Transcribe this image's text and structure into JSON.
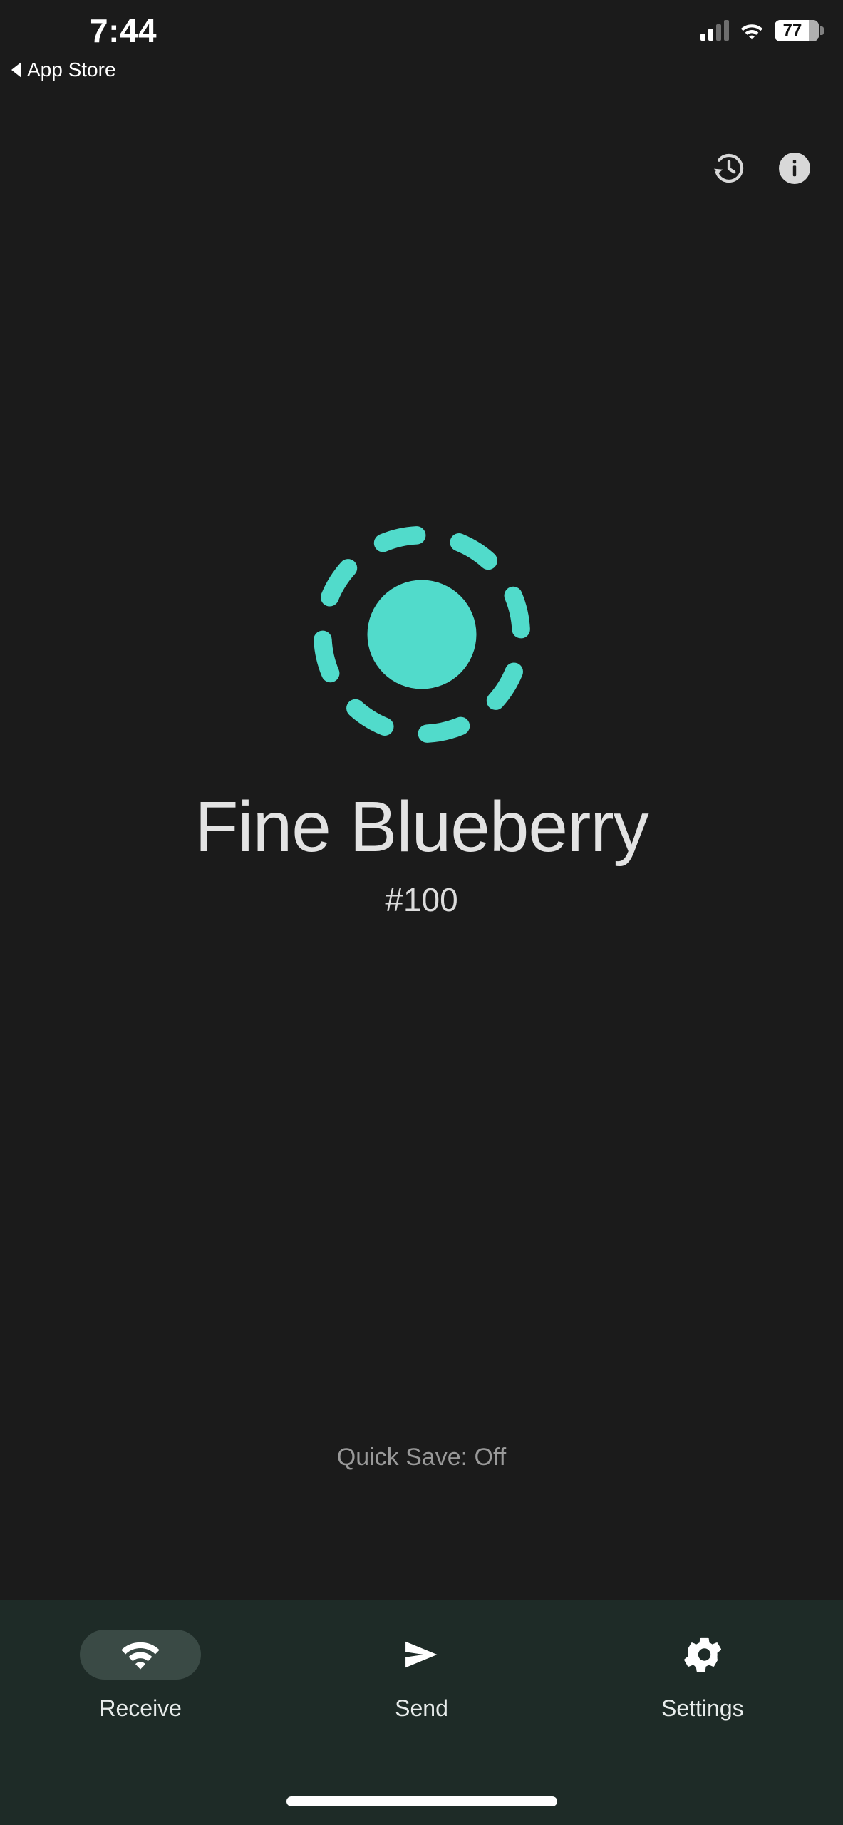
{
  "status_bar": {
    "time": "7:44",
    "back_label": "App Store",
    "back_icon": "triangle-left-icon",
    "signal_icon": "cellular-signal-icon",
    "signal_bars_filled": 2,
    "signal_bars_total": 4,
    "wifi_icon": "wifi-icon",
    "battery_icon": "battery-icon",
    "battery_percent": "77"
  },
  "top_actions": {
    "history": {
      "label": "History",
      "icon": "history-clock-icon"
    },
    "info": {
      "label": "Info",
      "icon": "info-circle-icon"
    }
  },
  "hero": {
    "logo_icon": "pairdrop-dashed-ring-logo",
    "device_name": "Fine Blueberry",
    "device_id": "#100"
  },
  "quick_save": {
    "text": "Quick Save: Off"
  },
  "tabs": [
    {
      "label": "Receive",
      "icon": "wifi-receive-icon",
      "active": true
    },
    {
      "label": "Send",
      "icon": "paper-plane-send-icon",
      "active": false
    },
    {
      "label": "Settings",
      "icon": "gear-settings-icon",
      "active": false
    }
  ],
  "colors": {
    "background": "#1b1b1b",
    "accent_teal": "#51dbcb",
    "tabbar_background": "#1e2b27",
    "tab_active_pill": "#3a4a45",
    "primary_text": "#e3e3e3",
    "muted_text": "#9a9a9a"
  },
  "home_indicator": {
    "label": "Home indicator"
  }
}
